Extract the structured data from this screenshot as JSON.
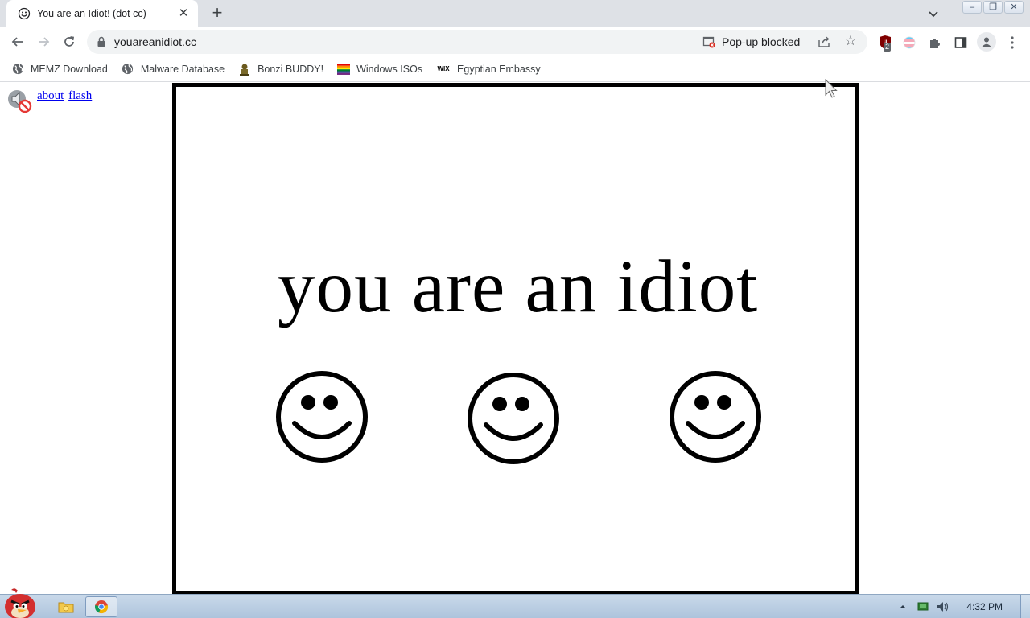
{
  "browser": {
    "tab": {
      "title": "You are an Idiot! (dot cc)",
      "close_glyph": "✕"
    },
    "new_tab_glyph": "+",
    "window_controls": {
      "minimize": "–",
      "restore": "❐",
      "close": "✕"
    },
    "address": {
      "url": "youareanidiot.cc"
    },
    "popup_status": "Pop-up blocked",
    "extension_badge": "2",
    "star_glyph": "☆",
    "bookmarks": [
      {
        "label": "MEMZ Download",
        "icon": "globe-icon"
      },
      {
        "label": "Malware Database",
        "icon": "globe-icon"
      },
      {
        "label": "Bonzi BUDDY!",
        "icon": "bonzi-icon"
      },
      {
        "label": "Windows ISOs",
        "icon": "rainbow-flag-icon"
      },
      {
        "label": "Egyptian Embassy",
        "icon": "wix-icon"
      }
    ],
    "wix_text": "WIX"
  },
  "page": {
    "links": {
      "about": "about",
      "flash": "flash"
    },
    "headline": "you are an idiot",
    "smileys": [
      "smiley-face-icon",
      "smiley-face-icon",
      "smiley-face-icon"
    ],
    "frame_border_color": "#000000"
  },
  "taskbar": {
    "clock": "4:32 PM",
    "apps": [
      "angry-bird-start-icon",
      "file-explorer-icon",
      "chrome-icon"
    ]
  },
  "colors": {
    "link": "#0000ee",
    "tabstrip": "#dee1e6",
    "omnibox": "#f1f3f4",
    "taskbar": "#aec4dc"
  }
}
